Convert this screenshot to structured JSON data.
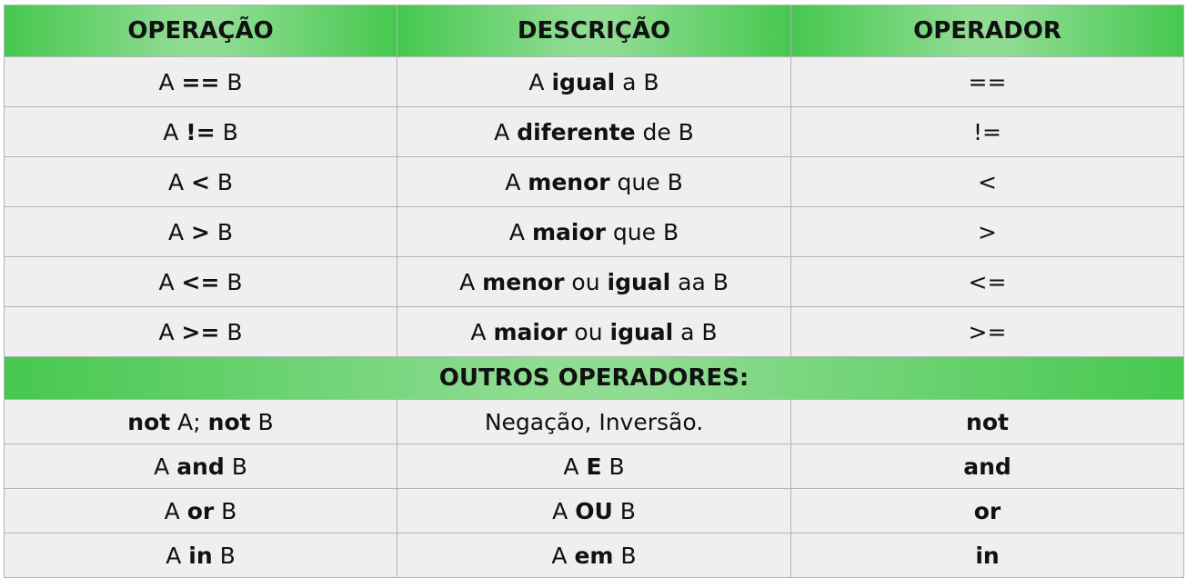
{
  "headers": [
    "OPERAÇÃO",
    "DESCRIÇÃO",
    "OPERADOR"
  ],
  "comparison_rows": [
    {
      "op": [
        [
          "A ",
          false
        ],
        [
          "==",
          true
        ],
        [
          " B",
          false
        ]
      ],
      "desc": [
        [
          "A ",
          false
        ],
        [
          "igual",
          true
        ],
        [
          " a B",
          false
        ]
      ],
      "symbol": [
        [
          "==",
          false
        ]
      ]
    },
    {
      "op": [
        [
          "A ",
          false
        ],
        [
          "!=",
          true
        ],
        [
          " B",
          false
        ]
      ],
      "desc": [
        [
          "A ",
          false
        ],
        [
          "diferente",
          true
        ],
        [
          " de B",
          false
        ]
      ],
      "symbol": [
        [
          "!=",
          false
        ]
      ]
    },
    {
      "op": [
        [
          "A ",
          false
        ],
        [
          "<",
          true
        ],
        [
          " B",
          false
        ]
      ],
      "desc": [
        [
          "A ",
          false
        ],
        [
          "menor",
          true
        ],
        [
          " que B",
          false
        ]
      ],
      "symbol": [
        [
          "<",
          false
        ]
      ]
    },
    {
      "op": [
        [
          "A ",
          false
        ],
        [
          ">",
          true
        ],
        [
          " B",
          false
        ]
      ],
      "desc": [
        [
          "A ",
          false
        ],
        [
          "maior",
          true
        ],
        [
          " que B",
          false
        ]
      ],
      "symbol": [
        [
          ">",
          false
        ]
      ]
    },
    {
      "op": [
        [
          "A ",
          false
        ],
        [
          "<=",
          true
        ],
        [
          " B",
          false
        ]
      ],
      "desc": [
        [
          "A ",
          false
        ],
        [
          "menor",
          true
        ],
        [
          " ou ",
          false
        ],
        [
          "igual",
          true
        ],
        [
          " aa B",
          false
        ]
      ],
      "symbol": [
        [
          "<=",
          false
        ]
      ]
    },
    {
      "op": [
        [
          "A ",
          false
        ],
        [
          ">=",
          true
        ],
        [
          " B",
          false
        ]
      ],
      "desc": [
        [
          "A ",
          false
        ],
        [
          "maior",
          true
        ],
        [
          " ou ",
          false
        ],
        [
          "igual",
          true
        ],
        [
          " a B",
          false
        ]
      ],
      "symbol": [
        [
          ">=",
          false
        ]
      ]
    }
  ],
  "section_title": "OUTROS OPERADORES:",
  "other_rows": [
    {
      "op": [
        [
          "not",
          true
        ],
        [
          " A; ",
          false
        ],
        [
          "not",
          true
        ],
        [
          " B",
          false
        ]
      ],
      "desc": [
        [
          "Negação, Inversão.",
          false
        ]
      ],
      "symbol": [
        [
          "not",
          true
        ]
      ]
    },
    {
      "op": [
        [
          "A ",
          false
        ],
        [
          "and",
          true
        ],
        [
          " B",
          false
        ]
      ],
      "desc": [
        [
          "A ",
          false
        ],
        [
          "E",
          true
        ],
        [
          " B",
          false
        ]
      ],
      "symbol": [
        [
          "and",
          true
        ]
      ]
    },
    {
      "op": [
        [
          "A ",
          false
        ],
        [
          "or",
          true
        ],
        [
          " B",
          false
        ]
      ],
      "desc": [
        [
          "A ",
          false
        ],
        [
          "OU",
          true
        ],
        [
          " B",
          false
        ]
      ],
      "symbol": [
        [
          "or",
          true
        ]
      ]
    },
    {
      "op": [
        [
          "A ",
          false
        ],
        [
          "in",
          true
        ],
        [
          " B",
          false
        ]
      ],
      "desc": [
        [
          "A ",
          false
        ],
        [
          "em",
          true
        ],
        [
          " B",
          false
        ]
      ],
      "symbol": [
        [
          "in",
          true
        ]
      ]
    }
  ]
}
